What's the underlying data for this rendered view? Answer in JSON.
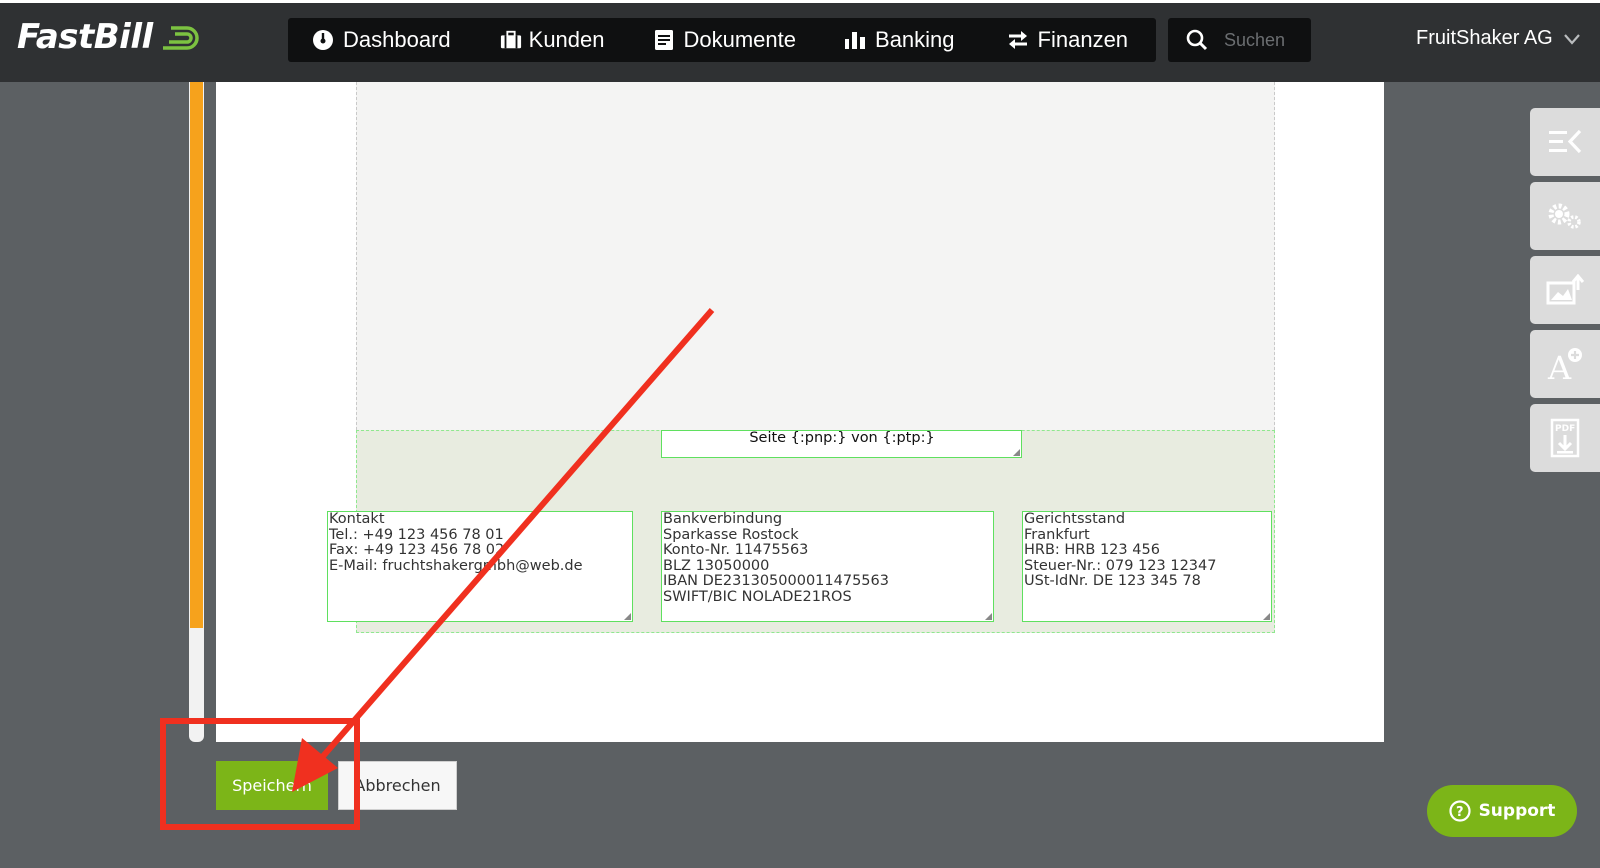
{
  "app": {
    "logo_text": "FastBill"
  },
  "nav": {
    "items": [
      {
        "label": "Dashboard",
        "icon": "speedometer-icon"
      },
      {
        "label": "Kunden",
        "icon": "briefcase-icon"
      },
      {
        "label": "Dokumente",
        "icon": "document-icon"
      },
      {
        "label": "Banking",
        "icon": "bar-chart-icon"
      },
      {
        "label": "Finanzen",
        "icon": "transfer-arrows-icon"
      }
    ]
  },
  "search": {
    "placeholder": "Suchen",
    "value": ""
  },
  "account": {
    "name": "FruitShaker AG"
  },
  "editor": {
    "page_number_field": "Seite {:pnp:} von {:ptp:}",
    "kontakt": [
      "Kontakt",
      "Tel.: +49 123 456 78 01",
      "Fax: +49 123 456 78 02",
      "E-Mail: fruchtshakergmbh@web.de"
    ],
    "bank": [
      "Bankverbindung",
      "Sparkasse Rostock",
      "Konto-Nr. 11475563",
      "BLZ 13050000",
      "IBAN DE23130500001147556​3",
      "SWIFT/BIC NOLADE21ROS"
    ],
    "gericht": [
      "Gerichtsstand",
      "Frankfurt",
      "HRB: HRB 123 456",
      "Steuer-Nr.: 079 123 12347",
      "USt-IdNr. DE 123 345 78"
    ]
  },
  "actions": {
    "save_label": "Speichern",
    "cancel_label": "Abbrechen"
  },
  "tools": [
    "collapse-panel-icon",
    "settings-gears-icon",
    "image-upload-icon",
    "add-text-icon",
    "pdf-download-icon"
  ],
  "support": {
    "label": "Support"
  },
  "colors": {
    "accent_green": "#7cb518",
    "scroll_orange": "#f6a21c",
    "annotation_red": "#f0301f",
    "topbar": "#2f3133"
  }
}
